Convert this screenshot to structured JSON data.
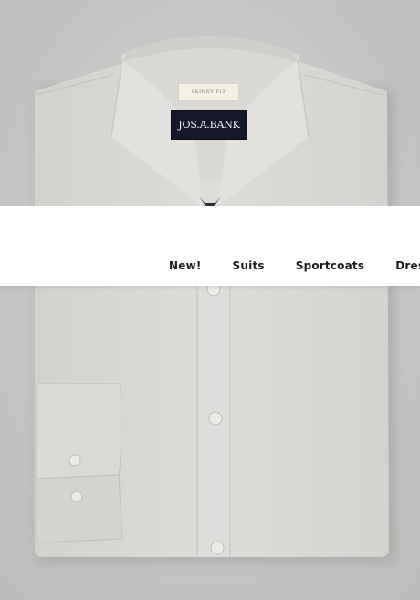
{
  "product": {
    "fit_label": "SKINNY FIT",
    "brand_label": "JOS.A.BANK",
    "shirt_color": "#dcdbd8",
    "background_color": "#c9c9c8"
  },
  "nav": {
    "items": [
      {
        "label": "New!"
      },
      {
        "label": "Suits"
      },
      {
        "label": "Sportcoats"
      },
      {
        "label": "Dress Shirts"
      }
    ]
  }
}
